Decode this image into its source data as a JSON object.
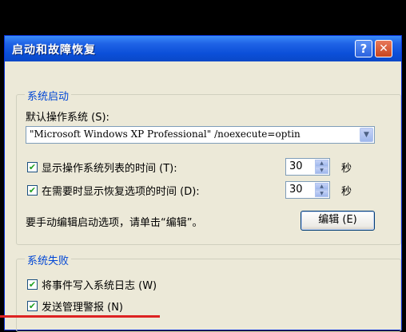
{
  "window": {
    "title": "启动和故障恢复",
    "help": "?",
    "close": "✕"
  },
  "startup": {
    "legend": "系统启动",
    "default_os_label": "默认操作系统 (S):",
    "default_os_value": "\"Microsoft Windows XP Professional\" /noexecute=optin",
    "show_list_label": "显示操作系统列表的时间 (T):",
    "show_list_checked": true,
    "show_list_value": "30",
    "show_recovery_label": "在需要时显示恢复选项的时间 (D):",
    "show_recovery_checked": true,
    "show_recovery_value": "30",
    "seconds_unit": "秒",
    "edit_hint": "要手动编辑启动选项，请单击“编辑”。",
    "edit_button": "编辑 (E)"
  },
  "failure": {
    "legend": "系统失败",
    "write_log_label": "将事件写入系统日志 (W)",
    "write_log_checked": true,
    "send_alert_label": "发送管理警报 (N)",
    "send_alert_checked": true
  }
}
